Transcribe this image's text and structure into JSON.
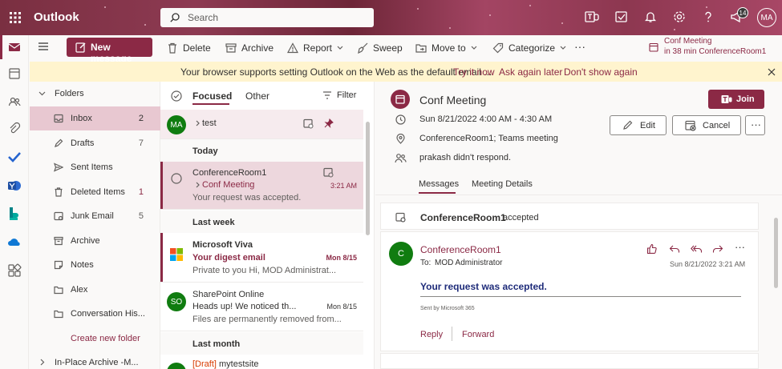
{
  "app": {
    "name": "Outlook",
    "user_initials": "MA",
    "notification_count": "14"
  },
  "search": {
    "placeholder": "Search"
  },
  "toolbar": {
    "new_message": "New message",
    "delete": "Delete",
    "archive": "Archive",
    "report": "Report",
    "sweep": "Sweep",
    "move_to": "Move to",
    "categorize": "Categorize",
    "more": "···"
  },
  "upcoming": {
    "title": "Conf Meeting",
    "when": "in 38 min ConferenceRoom1"
  },
  "banner": {
    "message": "Your browser supports setting Outlook on the Web as the default email ...",
    "try_it": "Try it now",
    "ask_later": "Ask again later",
    "dont_show": "Don't show again"
  },
  "folders": {
    "header": "Folders",
    "items": [
      {
        "label": "Inbox",
        "count": "2",
        "icon": "inbox-icon"
      },
      {
        "label": "Drafts",
        "count": "7",
        "icon": "drafts-icon"
      },
      {
        "label": "Sent Items",
        "count": "",
        "icon": "send-icon"
      },
      {
        "label": "Deleted Items",
        "count": "1",
        "icon": "trash-icon"
      },
      {
        "label": "Junk Email",
        "count": "5",
        "icon": "junk-icon"
      },
      {
        "label": "Archive",
        "count": "",
        "icon": "archive-icon"
      },
      {
        "label": "Notes",
        "count": "",
        "icon": "notes-icon"
      },
      {
        "label": "Alex",
        "count": "",
        "icon": "folder-icon"
      },
      {
        "label": "Conversation His...",
        "count": "",
        "icon": "folder-icon"
      }
    ],
    "create_new": "Create new folder",
    "archive_group": "In-Place Archive -M..."
  },
  "list": {
    "tabs": {
      "focused": "Focused",
      "other": "Other"
    },
    "filter": "Filter",
    "pinned": {
      "initials": "MA",
      "label": "test"
    },
    "sections": {
      "today": "Today",
      "last_week": "Last week",
      "last_month": "Last month"
    },
    "messages": [
      {
        "sender": "ConferenceRoom1",
        "subject": "Conf Meeting",
        "preview": "Your request was accepted.",
        "date": "3:21 AM"
      },
      {
        "sender": "Microsoft Viva",
        "subject": "Your digest email",
        "preview": "Private to you Hi, MOD Administrat...",
        "date": "Mon 8/15"
      },
      {
        "sender": "SharePoint Online",
        "initials": "SO",
        "subject": "Heads up! We noticed th...",
        "preview": "Files are permanently removed from...",
        "date": "Mon 8/15"
      },
      {
        "draft": "[Draft]",
        "subject": "mytestsite"
      }
    ]
  },
  "event": {
    "title": "Conf Meeting",
    "time": "Sun 8/21/2022 4:00 AM - 4:30 AM",
    "location": "ConferenceRoom1; Teams meeting",
    "attendees": "prakash didn't respond.",
    "join": "Join",
    "edit": "Edit",
    "cancel": "Cancel",
    "tabs": {
      "messages": "Messages",
      "details": "Meeting Details"
    }
  },
  "thread": {
    "summary_sender": "ConferenceRoom1",
    "summary_status": "accepted",
    "message": {
      "initial": "C",
      "sender": "ConferenceRoom1",
      "to_label": "To:",
      "to": "MOD Administrator",
      "date": "Sun 8/21/2022 3:21 AM",
      "body": "Your request was accepted.",
      "footer": "Sent by Microsoft 365",
      "reply": "Reply",
      "forward": "Forward"
    }
  },
  "colors": {
    "accent": "#8b2945",
    "avatar_green": "#107c10"
  }
}
